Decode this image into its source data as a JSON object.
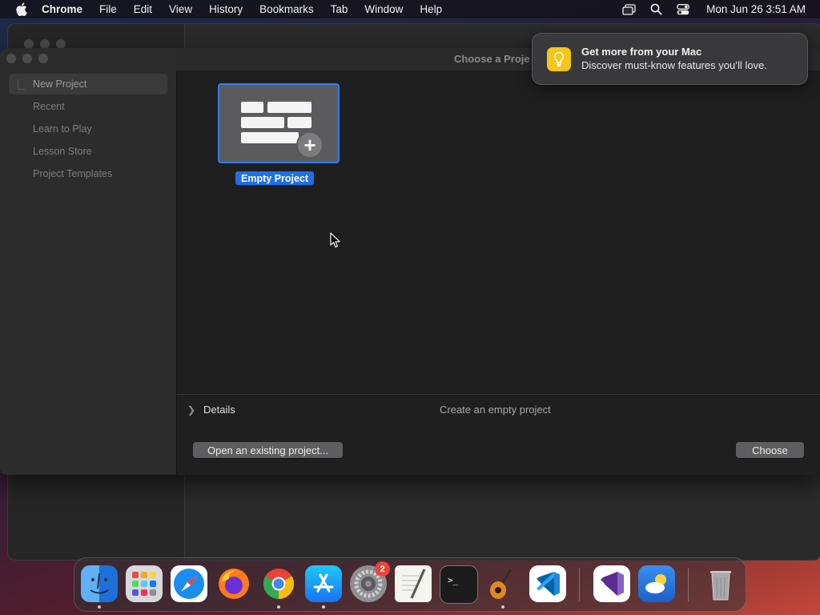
{
  "menubar": {
    "app": "Chrome",
    "items": [
      "File",
      "Edit",
      "View",
      "History",
      "Bookmarks",
      "Tab",
      "Window",
      "Help"
    ],
    "clock": "Mon Jun 26  3:51 AM",
    "status_icons": [
      "screen-mirroring-icon",
      "search-icon",
      "control-center-icon"
    ]
  },
  "window": {
    "title": "Choose a Proje",
    "sidebar": {
      "items": [
        {
          "label": "New Project",
          "selected": true
        },
        {
          "label": "Recent",
          "selected": false
        },
        {
          "label": "Learn to Play",
          "selected": false
        },
        {
          "label": "Lesson Store",
          "selected": false
        },
        {
          "label": "Project Templates",
          "selected": false
        }
      ]
    },
    "template": {
      "label": "Empty Project",
      "selected": true
    },
    "details": {
      "label": "Details",
      "description": "Create an empty project"
    },
    "buttons": {
      "open_existing": "Open an existing project...",
      "choose": "Choose"
    }
  },
  "notification": {
    "title": "Get more from your Mac",
    "body": "Discover must-know features you’ll love.",
    "icon": "lightbulb-icon"
  },
  "dock": {
    "apps": [
      "Finder",
      "Launchpad",
      "Safari",
      "Firefox",
      "Google Chrome",
      "App Store",
      "System Settings",
      "TextEdit",
      "Terminal",
      "GarageBand",
      "Visual Studio Code",
      "Visual Studio",
      "Weather",
      "Trash"
    ],
    "settings_badge": "2"
  },
  "colors": {
    "accent": "#2e7cf6",
    "selection_label": "#1f6fe6",
    "notification_icon": "#f5c518",
    "badge": "#e8453c"
  }
}
